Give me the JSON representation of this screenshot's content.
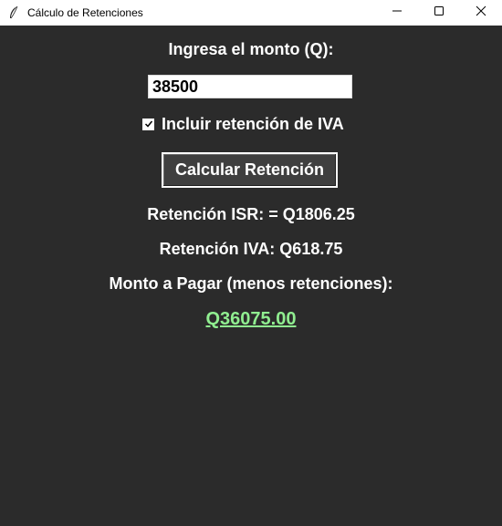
{
  "window": {
    "title": "Cálculo de Retenciones",
    "app_icon": "feather-icon",
    "controls": [
      "minimize-icon",
      "maximize-icon",
      "close-icon"
    ]
  },
  "form": {
    "prompt_label": "Ingresa el monto (Q):",
    "amount_value": "38500",
    "include_iva_label": "Incluir retención de IVA",
    "include_iva_checked": true,
    "calculate_button_label": "Calcular Retención"
  },
  "results": {
    "isr_text": "Retención ISR: = Q1806.25",
    "iva_text": "Retención IVA: Q618.75",
    "total_label": "Monto a Pagar (menos retenciones):",
    "total_value": "Q36075.00"
  },
  "colors": {
    "background": "#2b2b2b",
    "text": "#ffffff",
    "total_accent": "#90ee90",
    "titlebar": "#ffffff"
  }
}
